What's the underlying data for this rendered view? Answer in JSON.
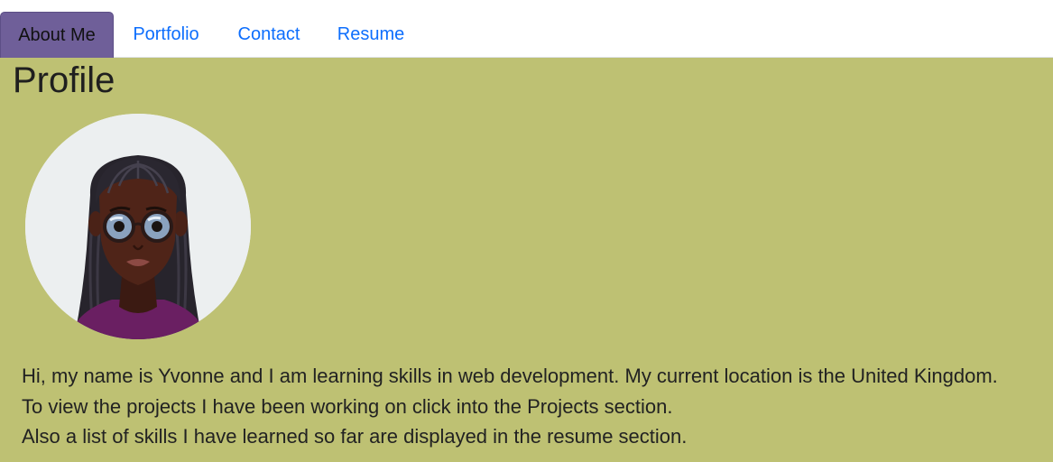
{
  "nav": {
    "tabs": [
      {
        "label": "About Me",
        "active": true
      },
      {
        "label": "Portfolio",
        "active": false
      },
      {
        "label": "Contact",
        "active": false
      },
      {
        "label": "Resume",
        "active": false
      }
    ]
  },
  "profile": {
    "title": "Profile",
    "avatar_icon": "avatar-illustration",
    "bio": [
      "Hi, my name is Yvonne and I am learning skills in web development. My current location is the United Kingdom.",
      "To view the projects I have been working on click into the Projects section.",
      "Also a list of skills I have learned so far are displayed in the resume section."
    ]
  },
  "colors": {
    "content_bg": "#bec173",
    "active_tab_bg": "#6f5f99",
    "link": "#0d6efd"
  }
}
